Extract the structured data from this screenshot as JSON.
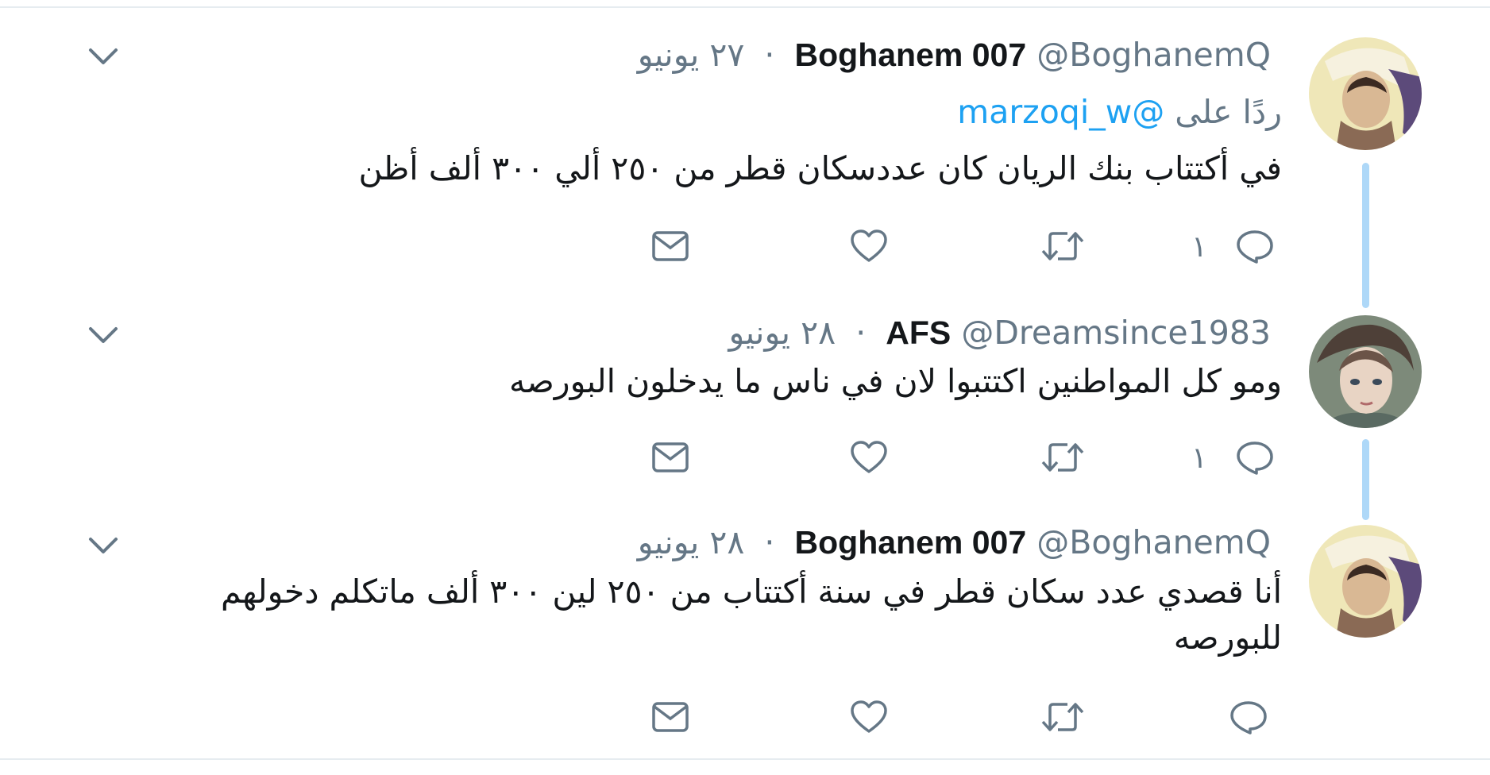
{
  "tweets": [
    {
      "name": "Boghanem 007",
      "handle": "@BoghanemQ",
      "separator": "·",
      "date": "٢٧ يونيو",
      "reply_prefix": "ردًا على",
      "reply_mention": "@marzoqi_w",
      "text": "في أكتتاب بنك الريان كان عددسكان قطر من ٢٥٠ ألي ٣٠٠ ألف أظن",
      "reply_count": "١",
      "avatar": "man-headscarf-avatar"
    },
    {
      "name": "AFS",
      "handle": "@Dreamsince1983",
      "separator": "·",
      "date": "٢٨ يونيو",
      "text": "ومو كل المواطنين اكتتبوا لان في ناس ما يدخلون البورصه",
      "reply_count": "١",
      "avatar": "woman-illustration-avatar"
    },
    {
      "name": "Boghanem 007",
      "handle": "@BoghanemQ",
      "separator": "·",
      "date": "٢٨ يونيو",
      "text": "أنا قصدي عدد سكان قطر في سنة أكتتاب من ٢٥٠ لين ٣٠٠ ألف ماتكلم دخولهم للبورصه",
      "reply_count": "",
      "avatar": "man-headscarf-avatar"
    }
  ],
  "icons": {
    "more": "chevron-down-icon",
    "reply": "reply-bubble-icon",
    "retweet": "retweet-icon",
    "like": "heart-icon",
    "dm": "envelope-icon"
  },
  "colors": {
    "text": "#14171a",
    "secondary": "#657786",
    "link": "#1da1f2",
    "thread_line": "#aed8f8",
    "divider": "#e6ecf0"
  }
}
